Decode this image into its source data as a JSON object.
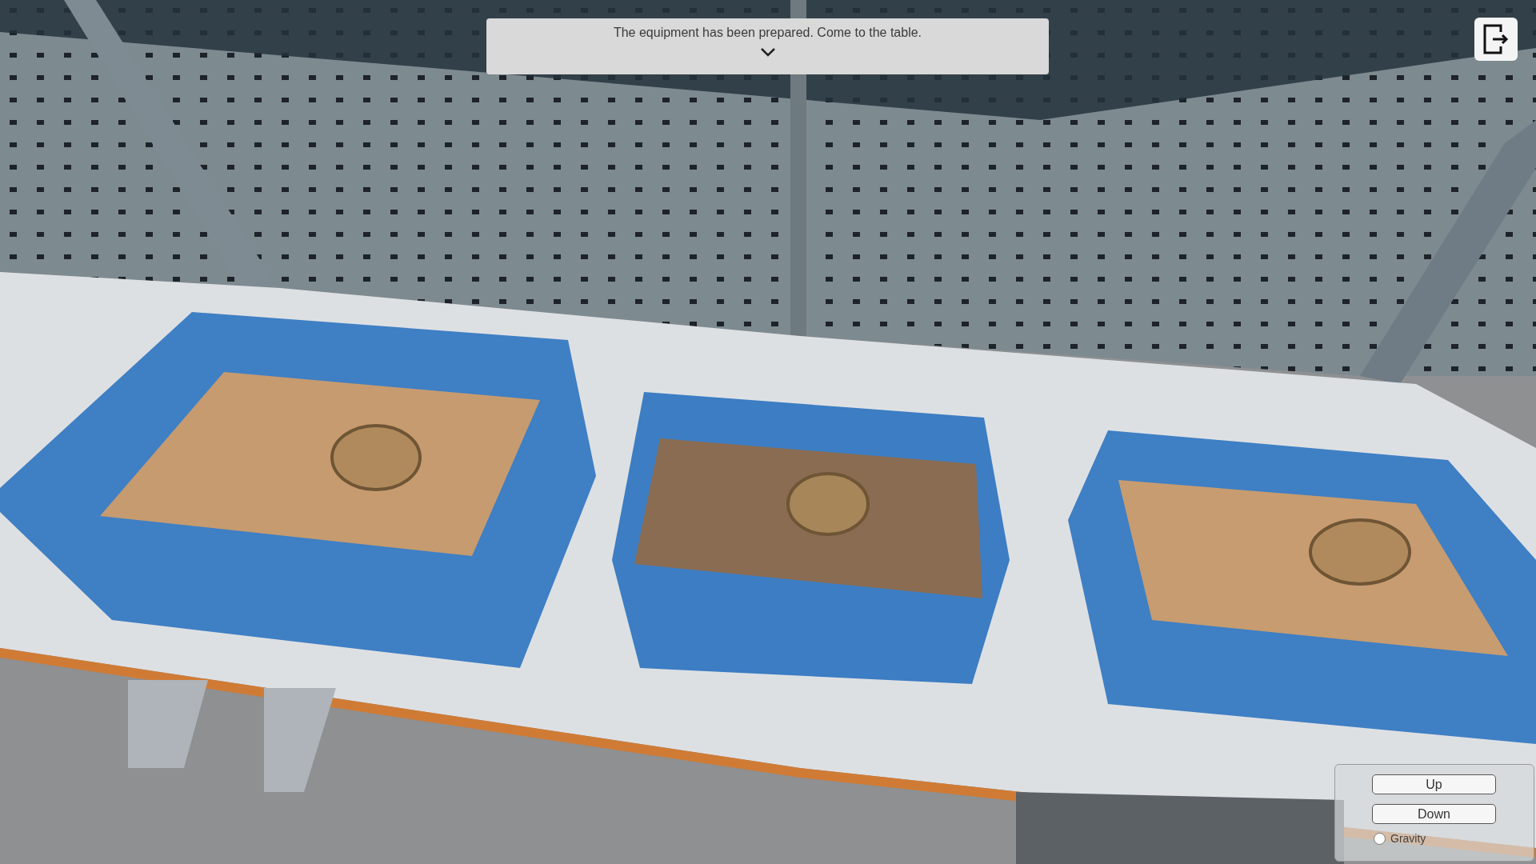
{
  "notice": {
    "message": "The equipment has been prepared. Come to the table.",
    "expanded": false
  },
  "controls": {
    "buttons": [
      "Up",
      "Down"
    ],
    "gravity": {
      "label": "Gravity",
      "checked": false
    }
  }
}
